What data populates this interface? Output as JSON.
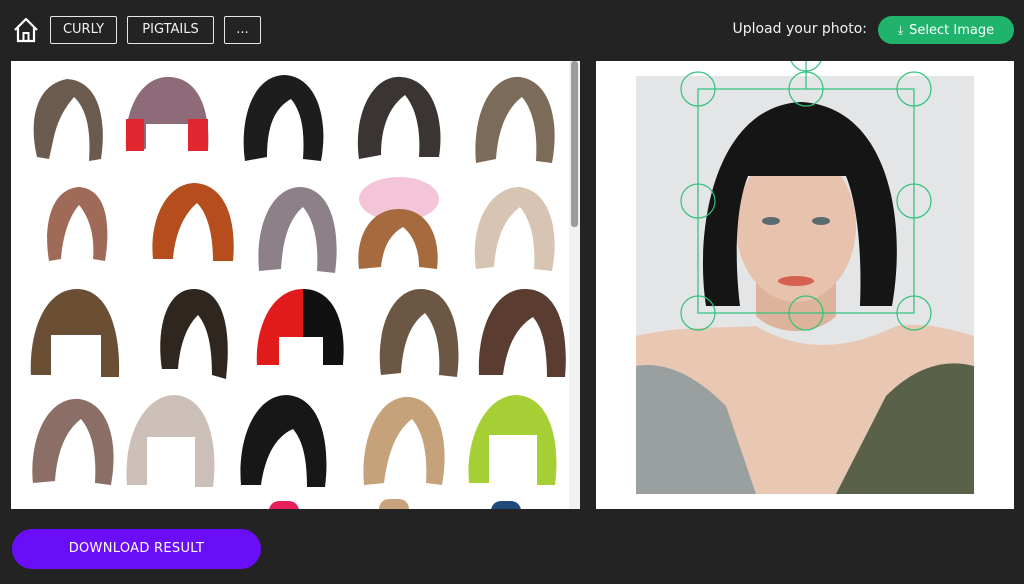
{
  "toolbar": {
    "home_icon": "home-icon",
    "filters": [
      "CURLY",
      "PIGTAILS",
      "..."
    ],
    "upload_label": "Upload your photo:",
    "select_image_label": "Select Image",
    "select_image_icon": "download-icon"
  },
  "gallery": {
    "scroll_position": 0.0
  },
  "preview": {
    "selection_handles": 9
  },
  "actions": {
    "download_label": "DOWNLOAD RESULT"
  },
  "colors": {
    "background": "#232323",
    "accent_green": "#1fb36b",
    "download_purple": "#6a0df8",
    "handle_green": "#2fc27a"
  }
}
